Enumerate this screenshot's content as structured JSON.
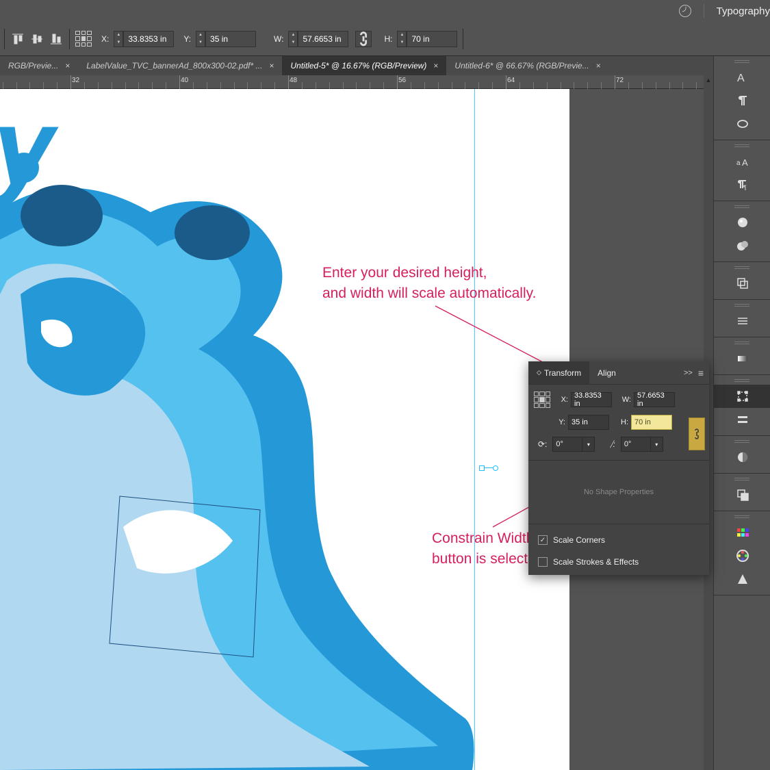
{
  "topbar": {
    "typography_label": "Typography"
  },
  "options": {
    "x_label": "X:",
    "x_value": "33.8353 in",
    "y_label": "Y:",
    "y_value": "35 in",
    "w_label": "W:",
    "w_value": "57.6653 in",
    "h_label": "H:",
    "h_value": "70 in"
  },
  "tabs": [
    {
      "label": "RGB/Previe...",
      "active": false
    },
    {
      "label": "LabelValue_TVC_bannerAd_800x300-02.pdf* ...",
      "active": false
    },
    {
      "label": "Untitled-5* @ 16.67% (RGB/Preview)",
      "active": true
    },
    {
      "label": "Untitled-6* @ 66.67% (RGB/Previe...",
      "active": false
    }
  ],
  "ruler": {
    "ticks": [
      32,
      40,
      48,
      56,
      64,
      72
    ]
  },
  "transform_panel": {
    "tab_transform": "Transform",
    "tab_align": "Align",
    "expand": ">>",
    "x_label": "X:",
    "x_value": "33.8353 in",
    "y_label": "Y:",
    "y_value": "35 in",
    "w_label": "W:",
    "w_value": "57.6653 in",
    "h_label": "H:",
    "h_value": "70 in",
    "rotate_value": "0°",
    "shear_value": "0°",
    "no_shape": "No Shape Properties",
    "scale_corners": "Scale Corners",
    "scale_strokes": "Scale Strokes & Effects",
    "scale_corners_checked": true,
    "scale_strokes_checked": false
  },
  "annotations": {
    "height_line1": "Enter your desired height,",
    "height_line2": "and width will scale automatically.",
    "constrain_line1": "Constrain Width and Height Proportions",
    "constrain_line2": "button is selected."
  }
}
